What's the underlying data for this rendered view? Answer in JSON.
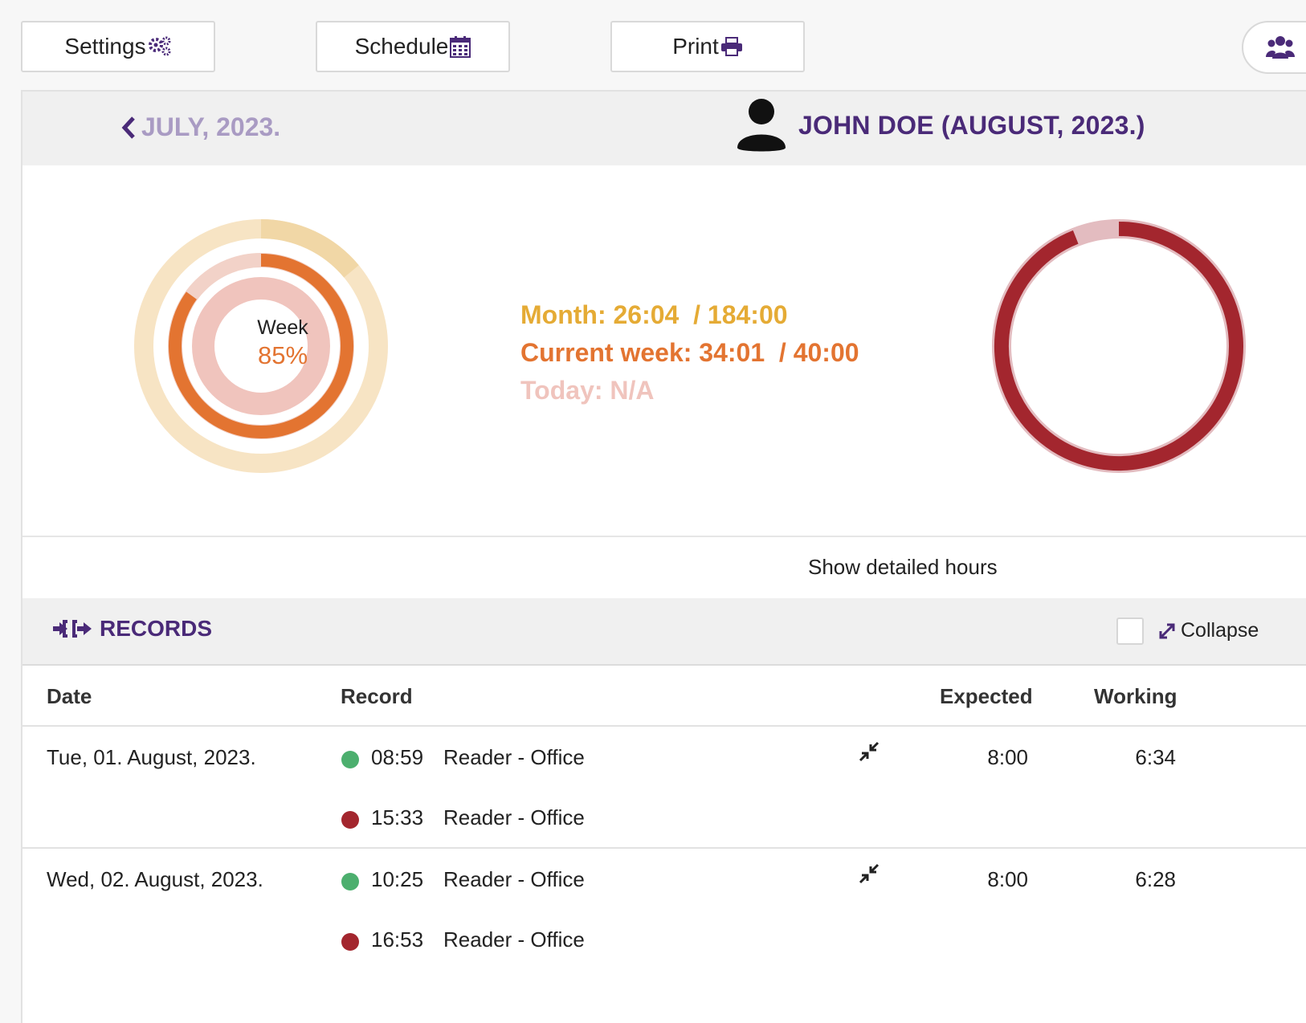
{
  "toolbar": {
    "settings_label": "Settings",
    "schedule_label": "Schedule",
    "print_label": "Print"
  },
  "month_nav": {
    "prev_label": "JULY, 2023.",
    "employee_label": "JOHN DOE (AUGUST, 2023.)"
  },
  "week_ring": {
    "center_title": "Week",
    "center_value": "85%",
    "month_progress": 0.14,
    "week_progress": 0.85
  },
  "stats": {
    "month": "Month: 26:04  / 184:00",
    "current_week": "Current week: 34:01  / 40:00",
    "today": "Today: N/A"
  },
  "right_ring": {
    "progress": 0.94
  },
  "colors": {
    "accent": "#4a2a78",
    "month": "#e5ab35",
    "week": "#e37431",
    "today": "#f0c4bd",
    "ring_red": "#a3262e",
    "dot_in": "#4caf6e",
    "dot_out": "#a3262e"
  },
  "show_detail_label": "Show detailed hours",
  "records": {
    "title": "RECORDS",
    "collapse_label": "Collapse",
    "headers": {
      "date": "Date",
      "record": "Record",
      "expected": "Expected",
      "working": "Working"
    },
    "rows": [
      {
        "date": "Tue, 01. August, 2023.",
        "expected": "8:00",
        "working": "6:34",
        "entries": [
          {
            "time": "08:59",
            "location": "Reader - Office",
            "type": "in"
          },
          {
            "time": "15:33",
            "location": "Reader - Office",
            "type": "out"
          }
        ]
      },
      {
        "date": "Wed, 02. August, 2023.",
        "expected": "8:00",
        "working": "6:28",
        "entries": [
          {
            "time": "10:25",
            "location": "Reader - Office",
            "type": "in"
          },
          {
            "time": "16:53",
            "location": "Reader - Office",
            "type": "out"
          }
        ]
      }
    ]
  }
}
